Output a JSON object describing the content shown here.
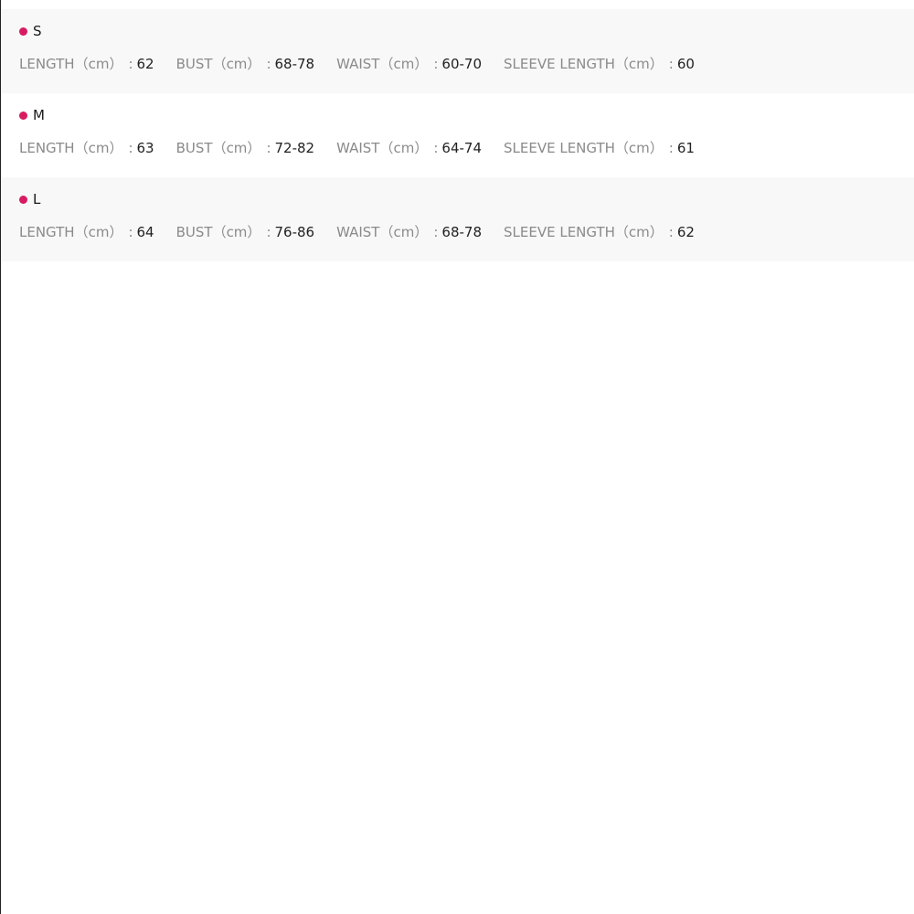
{
  "colors": {
    "bullet": "#d81b60"
  },
  "sizes": [
    {
      "name": "S",
      "measures": [
        {
          "label": "LENGTH（cm）",
          "value": "62"
        },
        {
          "label": "BUST（cm）",
          "value": "68-78"
        },
        {
          "label": "WAIST（cm）",
          "value": "60-70"
        },
        {
          "label": "SLEEVE LENGTH（cm）",
          "value": "60"
        }
      ]
    },
    {
      "name": "M",
      "measures": [
        {
          "label": "LENGTH（cm）",
          "value": "63"
        },
        {
          "label": "BUST（cm）",
          "value": "72-82"
        },
        {
          "label": "WAIST（cm）",
          "value": "64-74"
        },
        {
          "label": "SLEEVE LENGTH（cm）",
          "value": "61"
        }
      ]
    },
    {
      "name": "L",
      "measures": [
        {
          "label": "LENGTH（cm）",
          "value": "64"
        },
        {
          "label": "BUST（cm）",
          "value": "76-86"
        },
        {
          "label": "WAIST（cm）",
          "value": "68-78"
        },
        {
          "label": "SLEEVE LENGTH（cm）",
          "value": "62"
        }
      ]
    }
  ]
}
